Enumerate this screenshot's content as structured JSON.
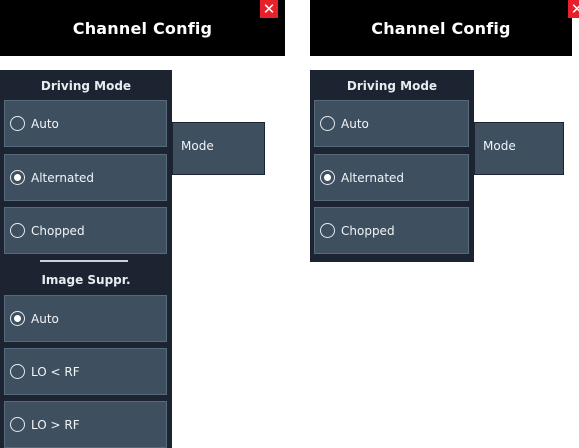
{
  "panels": [
    {
      "title": "Channel Config",
      "close_label": "✕",
      "driving_mode": {
        "header": "Driving Mode",
        "options": [
          {
            "label": "Auto",
            "selected": false
          },
          {
            "label": "Alternated",
            "selected": true
          },
          {
            "label": "Chopped",
            "selected": false
          }
        ]
      },
      "image_suppr": {
        "header": "Image Suppr.",
        "options": [
          {
            "label": "Auto",
            "selected": true
          },
          {
            "label": "LO < RF",
            "selected": false
          },
          {
            "label": "LO > RF",
            "selected": false
          }
        ]
      },
      "mode_label": "Mode"
    },
    {
      "title": "Channel Config",
      "close_label": "✕",
      "driving_mode": {
        "header": "Driving Mode",
        "options": [
          {
            "label": "Auto",
            "selected": false
          },
          {
            "label": "Alternated",
            "selected": true
          },
          {
            "label": "Chopped",
            "selected": false
          }
        ]
      },
      "mode_label": "Mode"
    }
  ],
  "colors": {
    "title_bg": "#000000",
    "panel_bg": "#1b2430",
    "button_bg": "#3e5060",
    "close_bg": "#e8202a"
  }
}
